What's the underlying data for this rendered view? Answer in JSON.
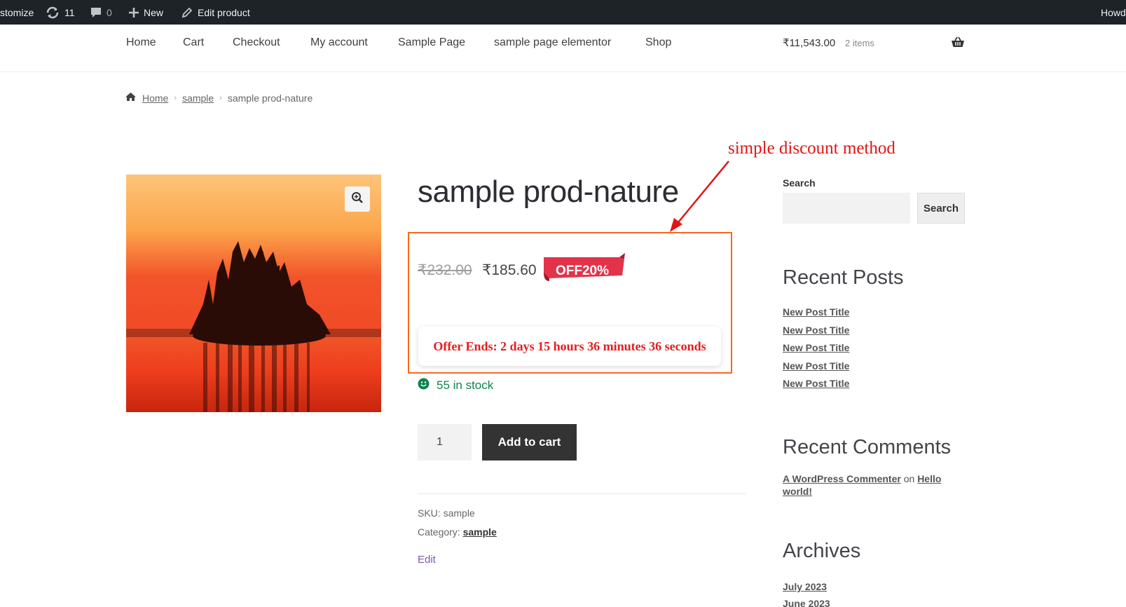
{
  "admin_bar": {
    "customize": "stomize",
    "updates_count": "11",
    "comments_count": "0",
    "new_label": "New",
    "edit_product": "Edit product",
    "howdy": "Howd"
  },
  "nav": {
    "items": [
      "Home",
      "Cart",
      "Checkout",
      "My account",
      "Sample Page",
      "sample page elementor",
      "Shop"
    ],
    "cart_amount": "₹11,543.00",
    "cart_count": "2 items"
  },
  "breadcrumb": {
    "home": "Home",
    "category": "sample",
    "current": "sample prod-nature",
    "separator": "›"
  },
  "annotation": {
    "text": "simple discount method",
    "color": "#e31313"
  },
  "product": {
    "title": "sample prod-nature",
    "old_price": "₹232.00",
    "new_price": "₹185.60",
    "badge": "OFF20%",
    "badge_color": "#e3334a",
    "offer_text": "Offer Ends: 2 days 15 hours 36 minutes 36 seconds",
    "stock": "55 in stock",
    "quantity": "1",
    "add_to_cart": "Add to cart",
    "sku_label": "SKU:",
    "sku": "sample",
    "category_label": "Category:",
    "category": "sample",
    "edit": "Edit"
  },
  "sidebar": {
    "search_label": "Search",
    "search_button": "Search",
    "recent_posts_heading": "Recent Posts",
    "recent_posts": [
      "New Post Title",
      "New Post Title",
      "New Post Title",
      "New Post Title",
      "New Post Title"
    ],
    "recent_comments_heading": "Recent Comments",
    "comment_author": "A WordPress Commenter",
    "comment_on": "on",
    "comment_post": "Hello world!",
    "archives_heading": "Archives",
    "archives": [
      "July 2023",
      "June 2023"
    ]
  },
  "colors": {
    "admin_bar_bg": "#1d2327",
    "highlight_border": "#f26b22",
    "stock_green": "#0f834d",
    "button_dark": "#333333"
  }
}
